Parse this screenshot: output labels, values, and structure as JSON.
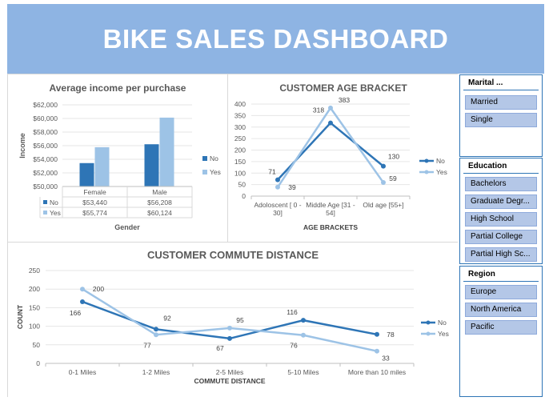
{
  "dashboard": {
    "title": "BIKE SALES DASHBOARD"
  },
  "slicers": {
    "marital": {
      "header": "Marital ...",
      "items": [
        "Married",
        "Single"
      ]
    },
    "education": {
      "header": "Education",
      "items": [
        "Bachelors",
        "Graduate Degr...",
        "High School",
        "Partial College",
        "Partial High Sc..."
      ]
    },
    "region": {
      "header": "Region",
      "items": [
        "Europe",
        "North America",
        "Pacific"
      ]
    }
  },
  "colors": {
    "no": "#2e75b6",
    "yes": "#9dc3e6",
    "banner": "#8eb4e3"
  },
  "chart_data": [
    {
      "type": "bar",
      "title": "Average income per purchase",
      "xlabel": "Gender",
      "ylabel": "Income",
      "categories": [
        "Female",
        "Male"
      ],
      "ylim": [
        50000,
        62000
      ],
      "yticks": [
        "$50,000",
        "$52,000",
        "$54,000",
        "$56,000",
        "$58,000",
        "$60,000",
        "$62,000"
      ],
      "series": [
        {
          "name": "No",
          "values": [
            53440,
            56208
          ],
          "labels": [
            "$53,440",
            "$56,208"
          ]
        },
        {
          "name": "Yes",
          "values": [
            55774,
            60124
          ],
          "labels": [
            "$55,774",
            "$60,124"
          ]
        }
      ],
      "legend": "right",
      "data_table": true
    },
    {
      "type": "line",
      "title": "CUSTOMER AGE BRACKET",
      "xlabel": "AGE BRACKETS",
      "ylabel": "",
      "categories": [
        [
          "Adoloscent [ 0 -",
          "30]"
        ],
        [
          "Middle Age [31 -",
          "54]"
        ],
        [
          "Old age [55+]"
        ]
      ],
      "ylim": [
        0,
        400
      ],
      "yticks": [
        0,
        50,
        100,
        150,
        200,
        250,
        300,
        350,
        400
      ],
      "series": [
        {
          "name": "No",
          "values": [
            71,
            318,
            130
          ]
        },
        {
          "name": "Yes",
          "values": [
            39,
            383,
            59
          ]
        }
      ],
      "legend": "right"
    },
    {
      "type": "line",
      "title": "CUSTOMER COMMUTE DISTANCE",
      "xlabel": "COMMUTE DISTANCE",
      "ylabel": "COUNT",
      "categories": [
        "0-1 Miles",
        "1-2 Miles",
        "2-5 Miles",
        "5-10 Miles",
        "More than 10 miles"
      ],
      "ylim": [
        0,
        250
      ],
      "yticks": [
        0,
        50,
        100,
        150,
        200,
        250
      ],
      "series": [
        {
          "name": "No",
          "values": [
            166,
            92,
            67,
            116,
            78
          ]
        },
        {
          "name": "Yes",
          "values": [
            200,
            77,
            95,
            76,
            33
          ]
        }
      ],
      "legend": "right"
    }
  ]
}
